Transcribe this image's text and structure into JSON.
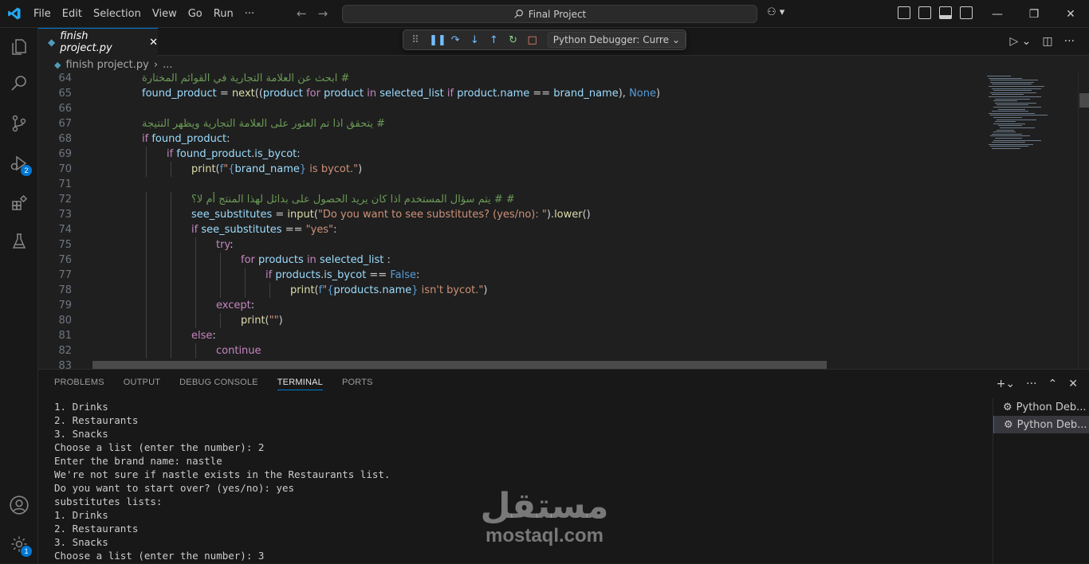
{
  "menu": [
    "File",
    "Edit",
    "Selection",
    "View",
    "Go",
    "Run",
    "···"
  ],
  "search": {
    "text": "Final Project"
  },
  "window_controls": [
    "—",
    "❐",
    "✕"
  ],
  "tab": {
    "label": "finish project.py",
    "close": "✕"
  },
  "breadcrumb": {
    "file": "finish project.py",
    "rest": "..."
  },
  "debug_toolbar": {
    "config": "Python Debugger: Curre"
  },
  "activity_badges": {
    "debug": "2",
    "settings": "1"
  },
  "code_lines": [
    {
      "n": "64",
      "indent": 2,
      "tokens": [
        [
          "cmt",
          "# ابحث عن العلامة التجارية في القوائم المختارة"
        ]
      ]
    },
    {
      "n": "65",
      "indent": 2,
      "tokens": [
        [
          "var",
          "found_product"
        ],
        [
          "",
          " = "
        ],
        [
          "fn",
          "next"
        ],
        [
          "",
          "(("
        ],
        [
          "var",
          "product"
        ],
        [
          "",
          " "
        ],
        [
          "kw",
          "for"
        ],
        [
          "",
          " "
        ],
        [
          "var",
          "product"
        ],
        [
          "",
          " "
        ],
        [
          "kw",
          "in"
        ],
        [
          "",
          " "
        ],
        [
          "var",
          "selected_list"
        ],
        [
          "",
          " "
        ],
        [
          "kw",
          "if"
        ],
        [
          "",
          " "
        ],
        [
          "var",
          "product"
        ],
        [
          "",
          "."
        ],
        [
          "var",
          "name"
        ],
        [
          "",
          " == "
        ],
        [
          "var",
          "brand_name"
        ],
        [
          "",
          "), "
        ],
        [
          "blue",
          "None"
        ],
        [
          "",
          ")"
        ]
      ]
    },
    {
      "n": "66",
      "indent": 0,
      "tokens": []
    },
    {
      "n": "67",
      "indent": 2,
      "tokens": [
        [
          "cmt",
          "# يتحقق اذا تم العثور على العلامة التجارية ويظهر النتيجة"
        ]
      ]
    },
    {
      "n": "68",
      "indent": 2,
      "tokens": [
        [
          "kw",
          "if"
        ],
        [
          "",
          " "
        ],
        [
          "var",
          "found_product"
        ],
        [
          "",
          ":"
        ]
      ]
    },
    {
      "n": "69",
      "indent": 3,
      "tokens": [
        [
          "kw",
          "if"
        ],
        [
          "",
          " "
        ],
        [
          "var",
          "found_product"
        ],
        [
          "",
          "."
        ],
        [
          "var",
          "is_bycot"
        ],
        [
          "",
          ":"
        ]
      ]
    },
    {
      "n": "70",
      "indent": 4,
      "tokens": [
        [
          "fn",
          "print"
        ],
        [
          "",
          "("
        ],
        [
          "blue",
          "f"
        ],
        [
          "str",
          "\""
        ],
        [
          "blue",
          "{"
        ],
        [
          "var",
          "brand_name"
        ],
        [
          "blue",
          "}"
        ],
        [
          "str",
          " is bycot.\""
        ],
        [
          "",
          ")"
        ]
      ]
    },
    {
      "n": "71",
      "indent": 0,
      "tokens": []
    },
    {
      "n": "72",
      "indent": 4,
      "tokens": [
        [
          "cmt",
          "# # يتم سؤال المستخدم اذا كان يريد الحصول على بدائل لهذا المنتج أم لا؟"
        ]
      ]
    },
    {
      "n": "73",
      "indent": 4,
      "tokens": [
        [
          "var",
          "see_substitutes"
        ],
        [
          "",
          " = "
        ],
        [
          "fn",
          "input"
        ],
        [
          "",
          "("
        ],
        [
          "str",
          "\"Do you want to see substitutes? (yes/no): \""
        ],
        [
          "",
          ")."
        ],
        [
          "fn",
          "lower"
        ],
        [
          "",
          "()"
        ]
      ]
    },
    {
      "n": "74",
      "indent": 4,
      "tokens": [
        [
          "kw",
          "if"
        ],
        [
          "",
          " "
        ],
        [
          "var",
          "see_substitutes"
        ],
        [
          "",
          " == "
        ],
        [
          "str",
          "\"yes\""
        ],
        [
          "",
          ":"
        ]
      ]
    },
    {
      "n": "75",
      "indent": 5,
      "tokens": [
        [
          "kw",
          "try"
        ],
        [
          "",
          ":"
        ]
      ]
    },
    {
      "n": "76",
      "indent": 6,
      "tokens": [
        [
          "kw",
          "for"
        ],
        [
          "",
          " "
        ],
        [
          "var",
          "products"
        ],
        [
          "",
          " "
        ],
        [
          "kw",
          "in"
        ],
        [
          "",
          " "
        ],
        [
          "var",
          "selected_list"
        ],
        [
          "",
          " :"
        ]
      ]
    },
    {
      "n": "77",
      "indent": 7,
      "tokens": [
        [
          "kw",
          "if"
        ],
        [
          "",
          " "
        ],
        [
          "var",
          "products"
        ],
        [
          "",
          "."
        ],
        [
          "var",
          "is_bycot"
        ],
        [
          "",
          " == "
        ],
        [
          "blue",
          "False"
        ],
        [
          "",
          ":"
        ]
      ]
    },
    {
      "n": "78",
      "indent": 8,
      "tokens": [
        [
          "fn",
          "print"
        ],
        [
          "",
          "("
        ],
        [
          "blue",
          "f"
        ],
        [
          "str",
          "\""
        ],
        [
          "blue",
          "{"
        ],
        [
          "var",
          "products"
        ],
        [
          "",
          "."
        ],
        [
          "var",
          "name"
        ],
        [
          "blue",
          "}"
        ],
        [
          "str",
          " isn't bycot.\""
        ],
        [
          "",
          ")"
        ]
      ]
    },
    {
      "n": "79",
      "indent": 5,
      "tokens": [
        [
          "kw",
          "except"
        ],
        [
          "",
          ":"
        ]
      ]
    },
    {
      "n": "80",
      "indent": 6,
      "tokens": [
        [
          "fn",
          "print"
        ],
        [
          "",
          "("
        ],
        [
          "str",
          "\"\""
        ],
        [
          "",
          ")"
        ]
      ]
    },
    {
      "n": "81",
      "indent": 4,
      "tokens": [
        [
          "kw",
          "else"
        ],
        [
          "",
          ":"
        ]
      ]
    },
    {
      "n": "82",
      "indent": 5,
      "tokens": [
        [
          "kw",
          "continue"
        ]
      ]
    },
    {
      "n": "83",
      "indent": 0,
      "tokens": []
    }
  ],
  "panel_tabs": [
    "PROBLEMS",
    "OUTPUT",
    "DEBUG CONSOLE",
    "TERMINAL",
    "PORTS"
  ],
  "active_panel_tab": "TERMINAL",
  "terminal_lines": [
    "1. Drinks",
    "2. Restaurants",
    "3. Snacks",
    "Choose a list (enter the number): 2",
    "Enter the brand name: nastle",
    "We're not sure if nastle exists in the Restaurants list.",
    "Do you want to start over? (yes/no): yes",
    "substitutes lists:",
    "1. Drinks",
    "2. Restaurants",
    "3. Snacks",
    "Choose a list (enter the number): 3"
  ],
  "terminal_sessions": [
    "Python Deb...",
    "Python Deb..."
  ],
  "watermark": {
    "arabic": "مستقل",
    "latin": "mostaql.com"
  }
}
